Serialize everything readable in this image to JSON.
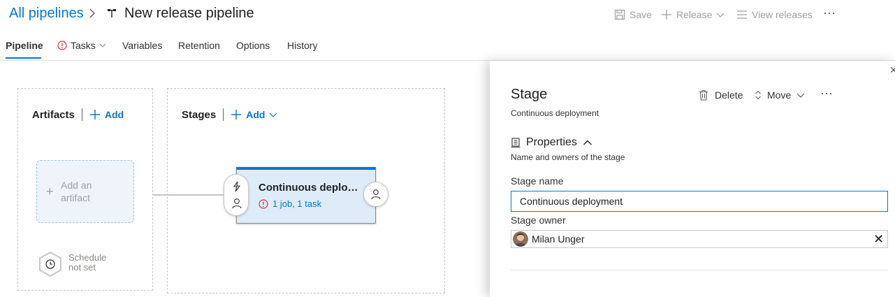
{
  "header": {
    "breadcrumb_root": "All pipelines",
    "title": "New release pipeline",
    "toolbar": {
      "save_label": "Save",
      "release_label": "Release",
      "view_releases_label": "View releases",
      "more_label": "⋯"
    }
  },
  "tabs": {
    "pipeline": "Pipeline",
    "tasks": "Tasks",
    "variables": "Variables",
    "retention": "Retention",
    "options": "Options",
    "history": "History"
  },
  "canvas": {
    "artifacts": {
      "heading": "Artifacts",
      "add_label": "Add",
      "placeholder_line1": "Add an",
      "placeholder_line2": "artifact",
      "schedule_line1": "Schedule",
      "schedule_line2": "not set"
    },
    "stages": {
      "heading": "Stages",
      "add_label": "Add",
      "stage_card": {
        "title": "Continuous deployment",
        "tasks_summary": "1 job, 1 task"
      }
    }
  },
  "panel": {
    "title": "Stage",
    "subtitle": "Continuous deployment",
    "delete_label": "Delete",
    "move_label": "Move",
    "more_label": "⋯",
    "properties": {
      "heading": "Properties",
      "description": "Name and owners of the stage",
      "stage_name_label": "Stage name",
      "stage_name_value": "Continuous deployment",
      "stage_owner_label": "Stage owner",
      "owner_name": "Milan Unger"
    }
  },
  "colors": {
    "accent": "#0078d4",
    "error": "#d13438",
    "card_bg": "#deecf9"
  },
  "icons": [
    "chevron-right-icon",
    "pipeline-icon",
    "save-icon",
    "plus-icon",
    "chevron-down-icon",
    "list-icon",
    "more-icon",
    "error-circle-icon",
    "lightning-icon",
    "person-icon",
    "clock-icon",
    "trash-icon",
    "up-down-icon",
    "clipboard-icon",
    "chevron-up-icon",
    "close-icon"
  ]
}
